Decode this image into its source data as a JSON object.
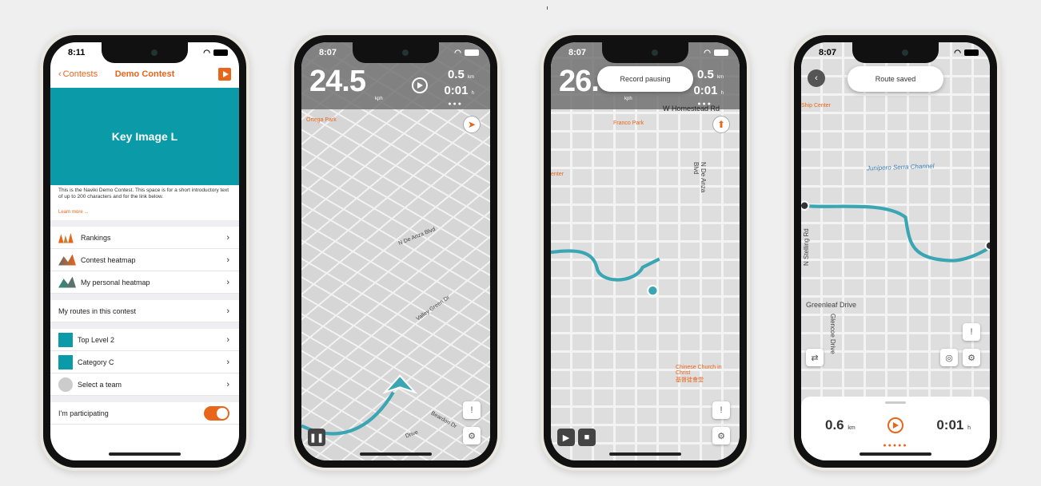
{
  "phone1": {
    "time": "8:11",
    "back_label": "Contests",
    "title": "Demo Contest",
    "key_image": "Key Image L",
    "description": "This is the Naviki Demo Contest. This space is for a short introductory text of up to 200 characters and for the link below.",
    "learn_more": "Learn more ...",
    "rows": {
      "rankings": "Rankings",
      "contest_heatmap": "Contest heatmap",
      "personal_heatmap": "My personal heatmap",
      "my_routes": "My routes in this contest",
      "top_level": "Top Level 2",
      "category": "Category C",
      "team": "Select a team",
      "participating": "I'm participating"
    }
  },
  "phone2": {
    "time": "8:07",
    "speed": "24.5",
    "speed_unit": "kph",
    "distance": "0.5",
    "distance_unit": "km",
    "duration": "0:01",
    "duration_unit": "h",
    "poi": "Ortega Park",
    "streets": [
      "N De Anza Blvd",
      "Valley Green Dr",
      "Beardon Dr",
      "Drive"
    ]
  },
  "phone3": {
    "time": "8:07",
    "speed": "26.",
    "speed_unit": "kph",
    "distance": "0.5",
    "distance_unit": "km",
    "duration": "0:01",
    "duration_unit": "h",
    "toast": "Record pausing",
    "streets": {
      "homestead": "W Homestead Rd",
      "de_anza": "N De Anza Blvd"
    },
    "poi": {
      "park": "Franco Park",
      "center": "enter",
      "church": "Chinese Church in Christ",
      "church_zh": "基督徒會堂"
    }
  },
  "phone4": {
    "time": "8:07",
    "toast": "Route saved",
    "poi": "Ship Center",
    "streets": {
      "channel": "Junipero Serra Channel",
      "stelling": "N Stelling Rd",
      "greenleaf": "Greenleaf Drive",
      "glencoe": "Glencoe Drive"
    },
    "distance": "0.6",
    "distance_unit": "km",
    "duration": "0:01",
    "duration_unit": "h"
  },
  "colors": {
    "accent": "#e8651a",
    "teal": "#0a9aa8",
    "route": "#3aa6b3"
  }
}
